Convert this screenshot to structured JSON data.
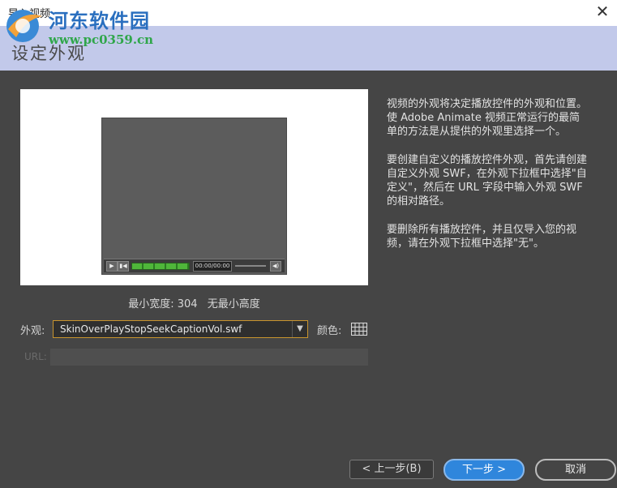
{
  "window": {
    "title": "导入视频",
    "close_glyph": "✕"
  },
  "watermark": {
    "name": "河东软件园",
    "url": "www.pc0359.cn"
  },
  "header": {
    "step_title": "设定外观"
  },
  "preview": {
    "timecode": "00:00/00:00"
  },
  "min_size": {
    "width_text": "最小宽度: 304",
    "height_text": "无最小高度"
  },
  "skin": {
    "label": "外观:",
    "selected": "SkinOverPlayStopSeekCaptionVol.swf",
    "color_label": "颜色:"
  },
  "url": {
    "label": "URL:",
    "value": ""
  },
  "description": {
    "p1": "视频的外观将决定播放控件的外观和位置。使 Adobe Animate 视频正常运行的最简单的方法是从提供的外观里选择一个。",
    "p2": "要创建自定义的播放控件外观，首先请创建自定义外观 SWF，在外观下拉框中选择\"自定义\"，然后在 URL 字段中输入外观 SWF 的相对路径。",
    "p3": "要删除所有播放控件，并且仅导入您的视频，请在外观下拉框中选择\"无\"。"
  },
  "buttons": {
    "prev": "< 上一步(B)",
    "next": "下一步 >",
    "cancel": "取消"
  },
  "colors": {
    "background": "#454545",
    "header_band": "#c2c9ea",
    "accent": "#2f86dc",
    "seek_fill": "#4fb63a",
    "select_border": "#c8942e"
  }
}
